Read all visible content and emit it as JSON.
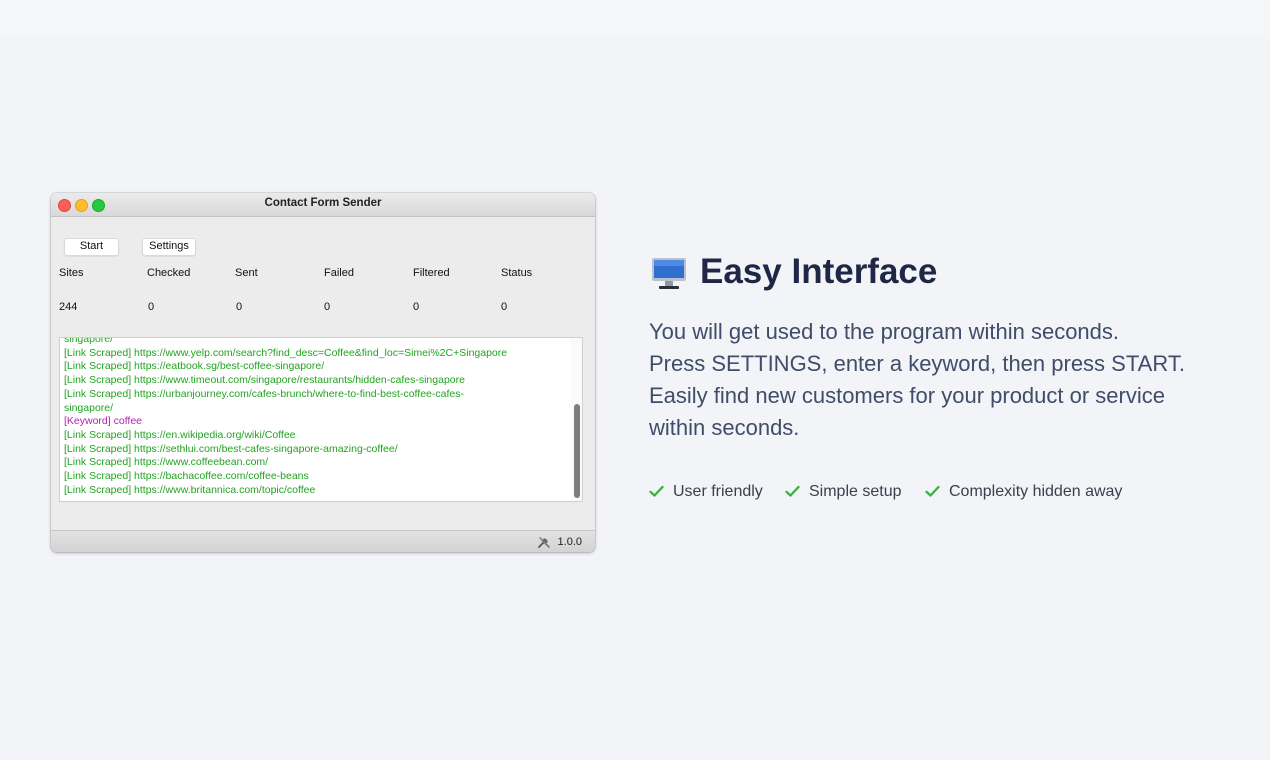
{
  "window": {
    "title": "Contact Form Sender",
    "buttons": {
      "start": "Start",
      "settings": "Settings"
    },
    "stats": {
      "labels": [
        "Sites",
        "Checked",
        "Sent",
        "Failed",
        "Filtered",
        "Status"
      ],
      "values": [
        "244",
        "0",
        "0",
        "0",
        "0",
        "0"
      ]
    },
    "log": [
      "singapore/",
      "[Link Scraped] https://www.yelp.com/search?find_desc=Coffee&find_loc=Simei%2C+Singapore",
      "[Link Scraped] https://eatbook.sg/best-coffee-singapore/",
      "[Link Scraped] https://www.timeout.com/singapore/restaurants/hidden-cafes-singapore",
      "[Link Scraped] https://urbanjourney.com/cafes-brunch/where-to-find-best-coffee-cafes-",
      "singapore/",
      "[Keyword] coffee",
      "[Link Scraped] https://en.wikipedia.org/wiki/Coffee",
      "[Link Scraped] https://sethlui.com/best-cafes-singapore-amazing-coffee/",
      "[Link Scraped] https://www.coffeebean.com/",
      "[Link Scraped] https://bachacoffee.com/coffee-beans",
      "[Link Scraped] https://www.britannica.com/topic/coffee"
    ],
    "version": "1.0.0"
  },
  "hero": {
    "heading": "Easy Interface",
    "lines": [
      "You will get used to the program within seconds.",
      "Press SETTINGS, enter a keyword, then press START.",
      "Easily find new customers for your product or service",
      "within seconds."
    ]
  },
  "features": [
    "User friendly",
    "Simple setup",
    "Complexity hidden away"
  ],
  "colors": {
    "background": "#f2f4f8",
    "heading": "#1f2747",
    "body_text": "#404c6a",
    "log_link": "#22a322",
    "log_keyword": "#b324b3",
    "check": "#3cb043"
  },
  "icons": [
    "monitor-icon",
    "check-icon",
    "tools-icon"
  ]
}
